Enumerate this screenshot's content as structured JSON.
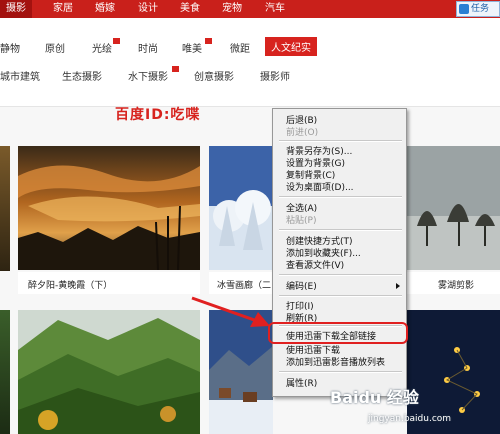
{
  "topnav": {
    "tabs": [
      "摄影",
      "家居",
      "婚嫁",
      "设计",
      "美食",
      "宠物",
      "汽车"
    ],
    "task_button": "任务"
  },
  "subnav": {
    "row1": [
      "静物",
      "原创",
      "光绘",
      "时尚",
      "唯美",
      "微距",
      "人文纪实"
    ],
    "row2": [
      "城市建筑",
      "生态摄影",
      "水下摄影",
      "创意摄影",
      "摄影师"
    ]
  },
  "watermark": "百度ID:吃喋",
  "photos": {
    "captions": [
      "醉夕阳-黄晚霞（下）",
      "冰雪画廊（二",
      "雾湖剪影"
    ]
  },
  "context_menu": {
    "items": [
      {
        "label": "后退(B)",
        "disabled": false
      },
      {
        "label": "前进(O)",
        "disabled": true
      },
      {
        "label": "背景另存为(S)...",
        "disabled": false
      },
      {
        "label": "设置为背景(G)",
        "disabled": false
      },
      {
        "label": "复制背景(C)",
        "disabled": false
      },
      {
        "label": "设为桌面项(D)...",
        "disabled": false
      },
      {
        "label": "全选(A)",
        "disabled": false
      },
      {
        "label": "粘贴(P)",
        "disabled": true
      },
      {
        "label": "创建快捷方式(T)",
        "disabled": false
      },
      {
        "label": "添加到收藏夹(F)...",
        "disabled": false
      },
      {
        "label": "查看源文件(V)",
        "disabled": false
      },
      {
        "label": "编码(E)",
        "disabled": false
      },
      {
        "label": "打印(I)",
        "disabled": false
      },
      {
        "label": "刷新(R)",
        "disabled": false
      },
      {
        "label": "使用迅雷下载全部链接",
        "disabled": false
      },
      {
        "label": "使用迅雷下载",
        "disabled": false
      },
      {
        "label": "添加到迅雷影音播放列表",
        "disabled": false
      },
      {
        "label": "属性(R)",
        "disabled": false
      }
    ]
  },
  "baidu": {
    "logo": "Baidu 经验",
    "url": "jingyan.baidu.com"
  },
  "colors": {
    "brand_red": "#c9201b",
    "highlight": "#e02020"
  }
}
